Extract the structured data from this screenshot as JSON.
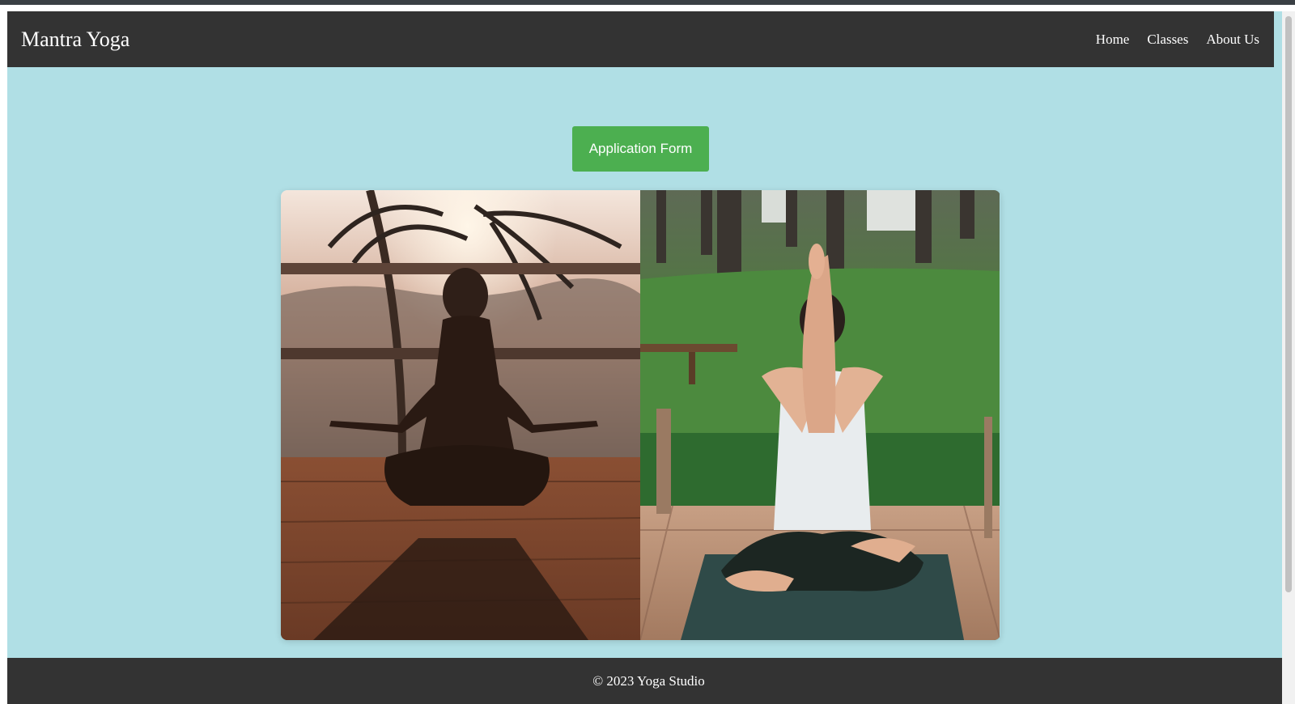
{
  "brand": "Mantra Yoga",
  "nav": {
    "items": [
      {
        "label": "Home"
      },
      {
        "label": "Classes"
      },
      {
        "label": "About Us"
      }
    ]
  },
  "cta": {
    "label": "Application Form"
  },
  "gallery": {
    "images": [
      {
        "icon": "meditation-sunset-photo"
      },
      {
        "icon": "eagle-arms-yoga-photo"
      }
    ]
  },
  "footer": {
    "text": "© 2023 Yoga Studio"
  },
  "colors": {
    "nav_bg": "#333333",
    "page_bg": "#b0dfe5",
    "button_bg": "#4caf50",
    "text_light": "#ffffff"
  }
}
